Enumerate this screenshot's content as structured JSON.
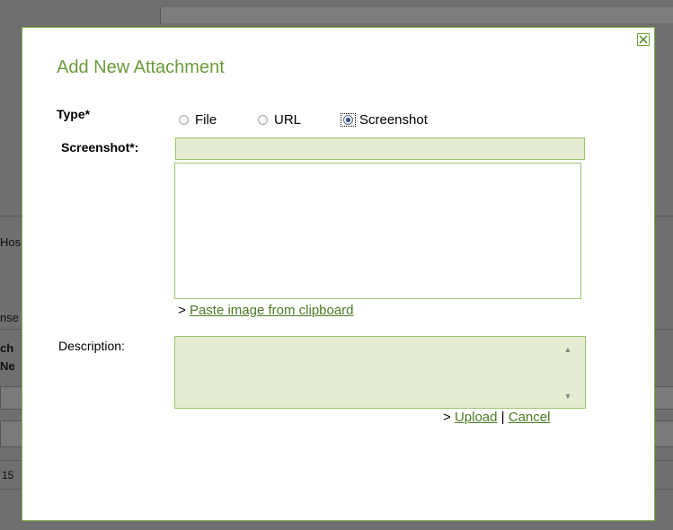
{
  "background": {
    "fragments": [
      "Hos",
      "nse",
      "ch",
      "Ne",
      "15"
    ]
  },
  "dialog": {
    "title": "Add New Attachment",
    "close_icon": "close-icon",
    "type_label": "Type*",
    "type_options": [
      {
        "label": "File",
        "selected": false
      },
      {
        "label": "URL",
        "selected": false
      },
      {
        "label": "Screenshot",
        "selected": true
      }
    ],
    "screenshot_label": "Screenshot*:",
    "paste_prefix": ">",
    "paste_link": "Paste image from clipboard",
    "description_label": "Description:",
    "actions_prefix": ">",
    "upload_label": "Upload",
    "separator": "|",
    "cancel_label": "Cancel"
  },
  "colors": {
    "accent": "#6a9a3a",
    "link": "#4a7a24",
    "field_bg": "#e3ecd0",
    "field_border": "#9fc46e",
    "overlay": "#6f6f6f"
  }
}
